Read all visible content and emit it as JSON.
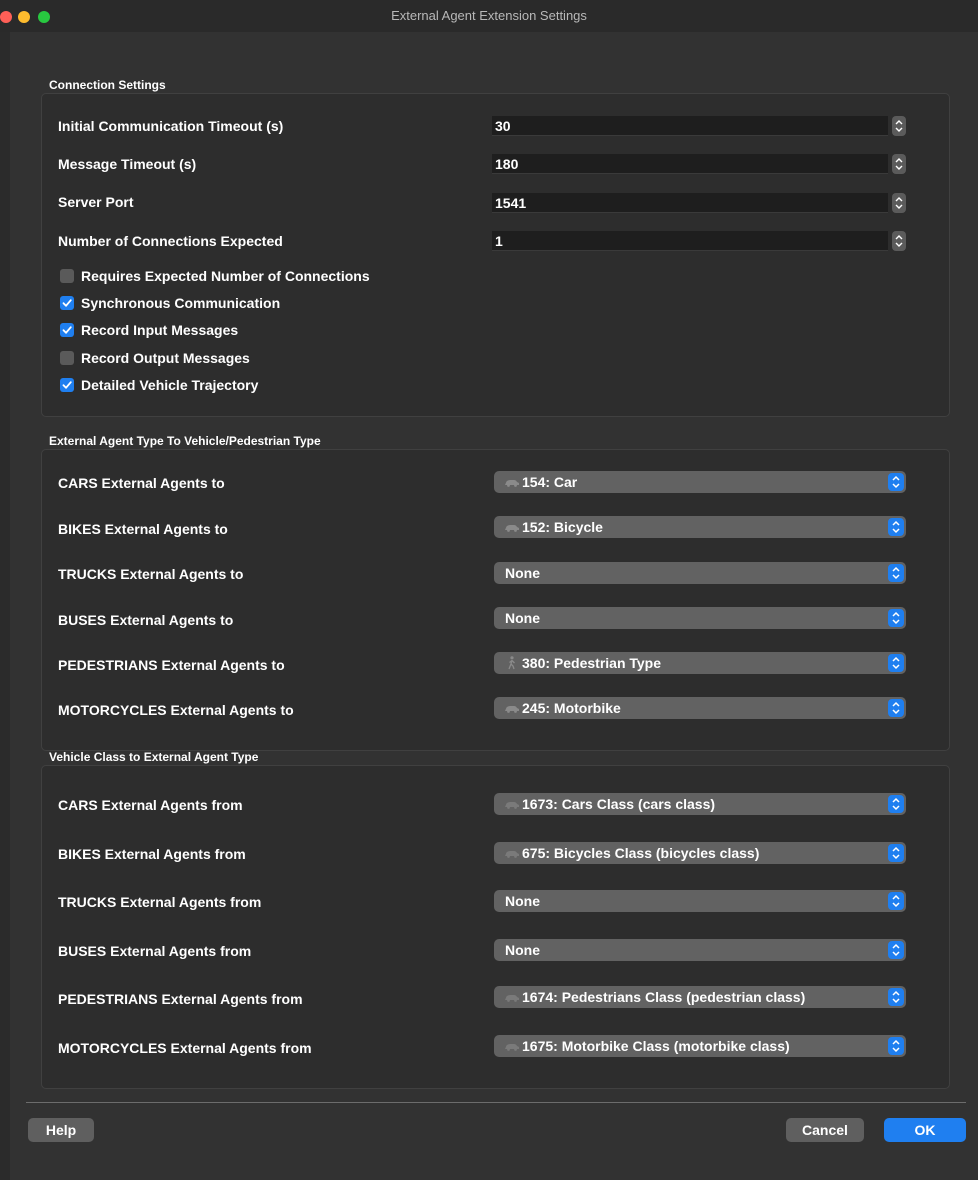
{
  "window": {
    "title": "External Agent Extension Settings"
  },
  "connection": {
    "section_title": "Connection Settings",
    "fields": [
      {
        "label": "Initial Communication Timeout (s)",
        "value": "30"
      },
      {
        "label": "Message Timeout (s)",
        "value": "180"
      },
      {
        "label": "Server Port",
        "value": "1541"
      },
      {
        "label": "Number of Connections Expected",
        "value": "1"
      }
    ],
    "checkboxes": [
      {
        "label": "Requires Expected Number of Connections",
        "checked": false
      },
      {
        "label": "Synchronous Communication",
        "checked": true
      },
      {
        "label": "Record Input Messages",
        "checked": true
      },
      {
        "label": "Record Output Messages",
        "checked": false
      },
      {
        "label": "Detailed Vehicle Trajectory",
        "checked": true
      }
    ]
  },
  "to_vehicle": {
    "section_title": "External Agent Type To Vehicle/Pedestrian Type",
    "rows": [
      {
        "label": "CARS External Agents to",
        "value": "154: Car",
        "icon": "car-icon"
      },
      {
        "label": "BIKES External Agents to",
        "value": "152: Bicycle",
        "icon": "car-icon"
      },
      {
        "label": "TRUCKS External Agents to",
        "value": "None",
        "icon": ""
      },
      {
        "label": "BUSES External Agents to",
        "value": "None",
        "icon": ""
      },
      {
        "label": "PEDESTRIANS External Agents to",
        "value": "380: Pedestrian Type",
        "icon": "pedestrian-icon"
      },
      {
        "label": "MOTORCYCLES External Agents to",
        "value": "245: Motorbike",
        "icon": "car-icon"
      }
    ]
  },
  "from_class": {
    "section_title": "Vehicle Class to External Agent Type",
    "rows": [
      {
        "label": "CARS External Agents from",
        "value": "1673: Cars Class (cars class)",
        "icon": "car-class-icon"
      },
      {
        "label": "BIKES External Agents from",
        "value": "675: Bicycles Class (bicycles class)",
        "icon": "car-class-icon"
      },
      {
        "label": "TRUCKS External Agents from",
        "value": "None",
        "icon": ""
      },
      {
        "label": "BUSES External Agents from",
        "value": "None",
        "icon": ""
      },
      {
        "label": "PEDESTRIANS External Agents from",
        "value": "1674: Pedestrians Class (pedestrian class)",
        "icon": "car-class-icon"
      },
      {
        "label": "MOTORCYCLES External Agents from",
        "value": "1675: Motorbike Class (motorbike class)",
        "icon": "car-class-icon"
      }
    ]
  },
  "buttons": {
    "help": "Help",
    "cancel": "Cancel",
    "ok": "OK"
  },
  "colors": {
    "accent": "#1f7ff0",
    "window_bg": "#323232",
    "group_bg": "#2d2d2d"
  }
}
